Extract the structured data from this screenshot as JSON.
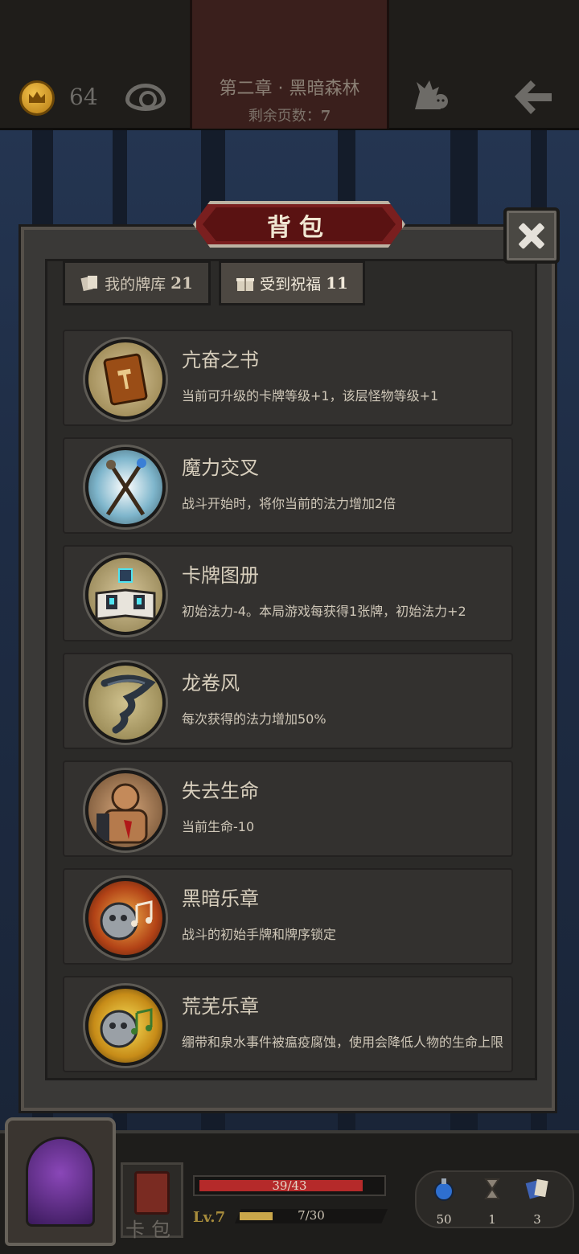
{
  "top": {
    "coins": "64",
    "chapter": "第二章 · 黑暗森林",
    "pages_left_label": "剩余页数：",
    "pages_left_value": "7"
  },
  "panel": {
    "title": "背包",
    "tabs": [
      {
        "label": "我的牌库",
        "count": "21",
        "icon": "cards-icon",
        "active": false
      },
      {
        "label": "受到祝福",
        "count": "11",
        "icon": "gift-icon",
        "active": true
      }
    ]
  },
  "items": [
    {
      "name": "亢奋之书",
      "desc": "当前可升级的卡牌等级+1，该层怪物等级+1",
      "icon": "book-icon"
    },
    {
      "name": "魔力交叉",
      "desc": "战斗开始时，将你当前的法力增加2倍",
      "icon": "crossed-staves-icon"
    },
    {
      "name": "卡牌图册",
      "desc": "初始法力-4。本局游戏每获得1张牌，初始法力+2",
      "icon": "card-album-icon"
    },
    {
      "name": "龙卷风",
      "desc": "每次获得的法力增加50%",
      "icon": "tornado-icon"
    },
    {
      "name": "失去生命",
      "desc": "当前生命-10",
      "icon": "bleeding-brute-icon"
    },
    {
      "name": "黑暗乐章",
      "desc": "战斗的初始手牌和牌序锁定",
      "icon": "dark-music-icon"
    },
    {
      "name": "荒芜乐章",
      "desc": "绷带和泉水事件被瘟疫腐蚀，使用会降低人物的生命上限",
      "icon": "barren-music-icon"
    }
  ],
  "bottom": {
    "deck_label": "卡包",
    "hp_text": "39/43",
    "hp_fraction": 0.907,
    "level": "Lv.7",
    "xp_text": "7/30",
    "xp_fraction": 0.233,
    "resources": [
      {
        "icon": "mana-potion-icon",
        "value": "50"
      },
      {
        "icon": "hourglass-icon",
        "value": "1"
      },
      {
        "icon": "cards-stack-icon",
        "value": "3"
      }
    ]
  }
}
